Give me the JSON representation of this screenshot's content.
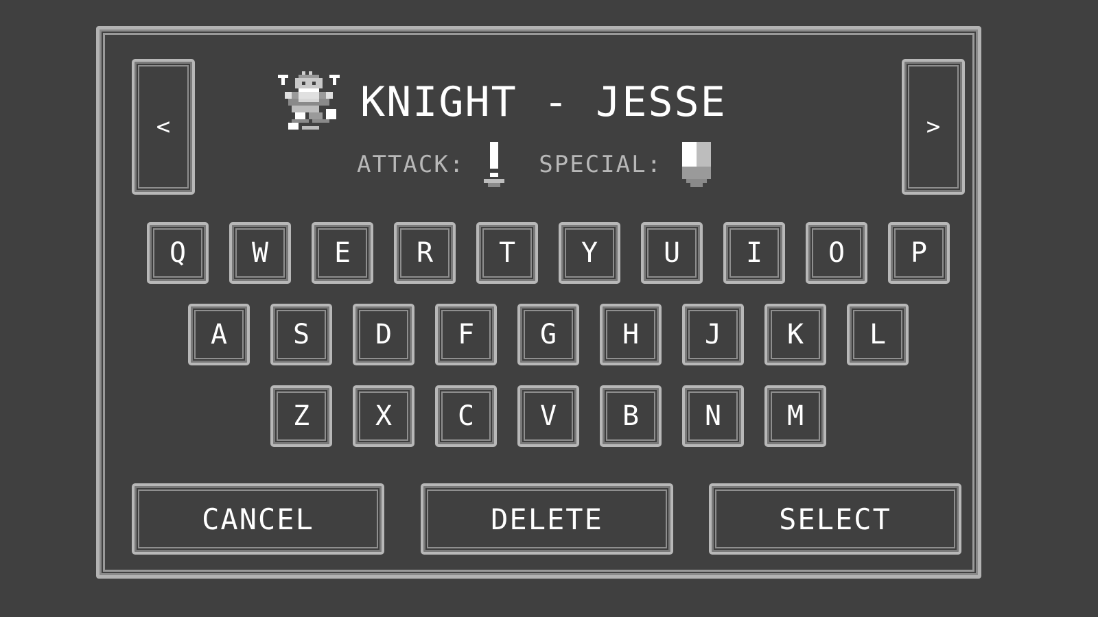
{
  "header": {
    "title": "KNIGHT - JESSE",
    "attack_label": "ATTACK:",
    "special_label": "SPECIAL:",
    "character_icon": "knight-sprite-icon",
    "attack_icon": "sword-icon",
    "special_icon": "shield-icon"
  },
  "nav": {
    "prev_label": "<",
    "next_label": ">"
  },
  "keyboard": {
    "rows": [
      [
        "Q",
        "W",
        "E",
        "R",
        "T",
        "Y",
        "U",
        "I",
        "O",
        "P"
      ],
      [
        "A",
        "S",
        "D",
        "F",
        "G",
        "H",
        "J",
        "K",
        "L"
      ],
      [
        "Z",
        "X",
        "C",
        "V",
        "B",
        "N",
        "M"
      ]
    ]
  },
  "actions": {
    "cancel_label": "CANCEL",
    "delete_label": "DELETE",
    "select_label": "SELECT"
  },
  "colors": {
    "background": "#404040",
    "border": "#b8b8b8",
    "text": "#ffffff",
    "muted_text": "#b8b8b8"
  }
}
